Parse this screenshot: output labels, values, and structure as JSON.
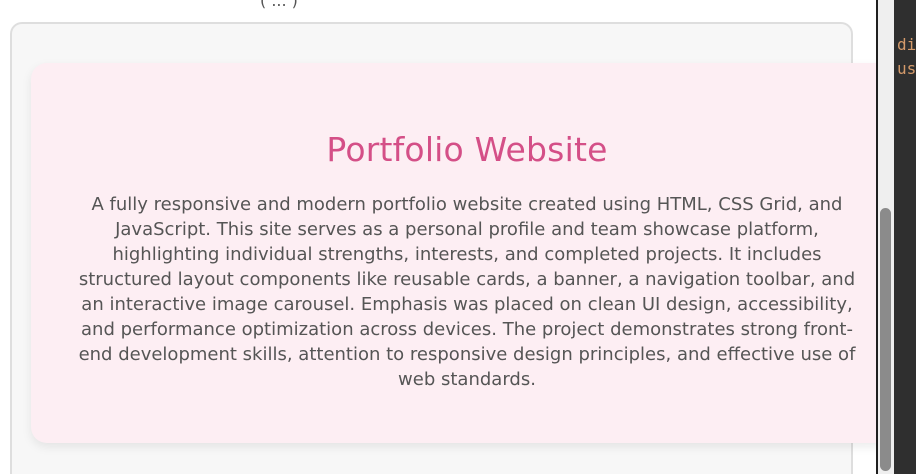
{
  "page": {
    "top_fragment": "( ... )"
  },
  "project_card": {
    "title": "Portfolio Website",
    "description": "A fully responsive and modern portfolio website created using HTML, CSS Grid, and JavaScript. This site serves as a personal profile and team showcase platform, highlighting individual strengths, interests, and completed projects. It includes structured layout components like reusable cards, a banner, a navigation toolbar, and an interactive image carousel. Emphasis was placed on clean UI design, accessibility, and performance optimization across devices. The project demonstrates strong front-end development skills, attention to responsive design principles, and effective use of web standards."
  },
  "sidebar": {
    "code_lines": [
      "di",
      "us"
    ]
  },
  "theme": {
    "title_color": "#d44f87",
    "card_background": "#fdeef3",
    "panel_background": "#f7f7f7",
    "text_color": "#555555",
    "code_color": "#d49a6a"
  }
}
